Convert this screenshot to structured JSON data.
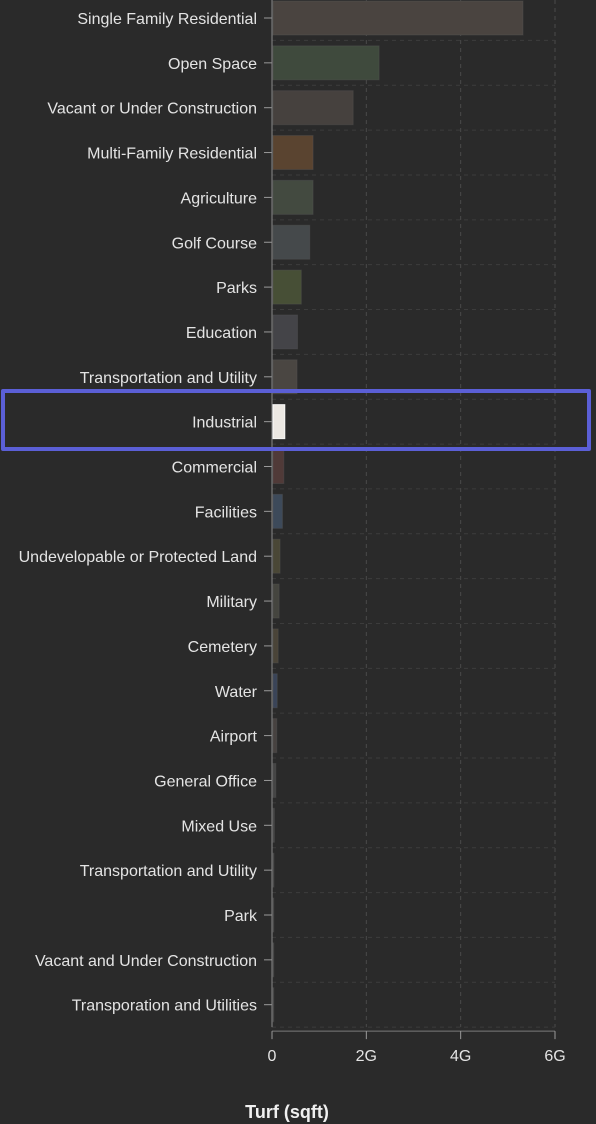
{
  "chart_data": {
    "type": "bar",
    "orientation": "horizontal",
    "xlabel": "Turf (sqft)",
    "ylabel": "",
    "xlim": [
      0,
      6000000000
    ],
    "xticks": [
      {
        "value": 0,
        "label": "0"
      },
      {
        "value": 2000000000,
        "label": "2G"
      },
      {
        "value": 4000000000,
        "label": "4G"
      },
      {
        "value": 6000000000,
        "label": "6G"
      }
    ],
    "grid": true,
    "highlighted_category": "Industrial",
    "categories": [
      "Single Family Residential",
      "Open Space",
      "Vacant or Under Construction",
      "Multi-Family Residential",
      "Agriculture",
      "Golf Course",
      "Parks",
      "Education",
      "Transportation and Utility",
      "Industrial",
      "Commercial",
      "Facilities",
      "Undevelopable or Protected Land",
      "Military",
      "Cemetery",
      "Water",
      "Airport",
      "General Office",
      "Mixed Use",
      "Transportation and Utility",
      "Park",
      "Vacant and Under Construction",
      "Transporation and Utilities"
    ],
    "values": [
      5300000000,
      2250000000,
      1700000000,
      850000000,
      850000000,
      780000000,
      600000000,
      520000000,
      510000000,
      250000000,
      230000000,
      200000000,
      150000000,
      130000000,
      110000000,
      90000000,
      80000000,
      60000000,
      30000000,
      20000000,
      10000000,
      5000000,
      3000000
    ],
    "colors": [
      "#4a4440",
      "#3f4a3d",
      "#46413e",
      "#5a4430",
      "#434a40",
      "#45494b",
      "#474f36",
      "#444448",
      "#4a4642",
      "#ece8e3",
      "#503a38",
      "#3d4a5a",
      "#4a4736",
      "#45453f",
      "#4a4438",
      "#3a4458",
      "#474240",
      "#454545",
      "#454545",
      "#454545",
      "#454545",
      "#454545",
      "#454545"
    ],
    "highlight_color": "#5b5fd6"
  }
}
